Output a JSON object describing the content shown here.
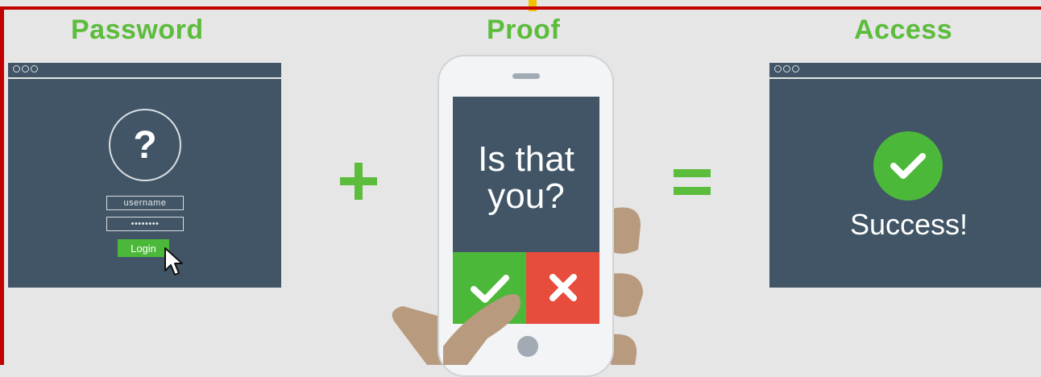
{
  "headings": {
    "password": "Password",
    "proof": "Proof",
    "access": "Access"
  },
  "login_window": {
    "icon": "question-icon",
    "symbol": "?",
    "username_field": "username",
    "password_field": "••••••••",
    "login_button": "Login",
    "cursor_icon": "mouse-pointer-icon"
  },
  "operators": {
    "plus": "+",
    "equals": "="
  },
  "phone": {
    "prompt_line1": "Is that",
    "prompt_line2": "you?",
    "approve_icon": "checkmark-icon",
    "deny_icon": "x-icon"
  },
  "access_window": {
    "icon": "checkmark-circle-icon",
    "message": "Success!"
  },
  "colors": {
    "background": "#e6e6e6",
    "panel": "#415566",
    "accent_green": "#4cb83a",
    "heading_green": "#5cbc3c",
    "deny_red": "#e74c3c",
    "frame_red": "#c10000",
    "skin": "#b89a7e"
  }
}
